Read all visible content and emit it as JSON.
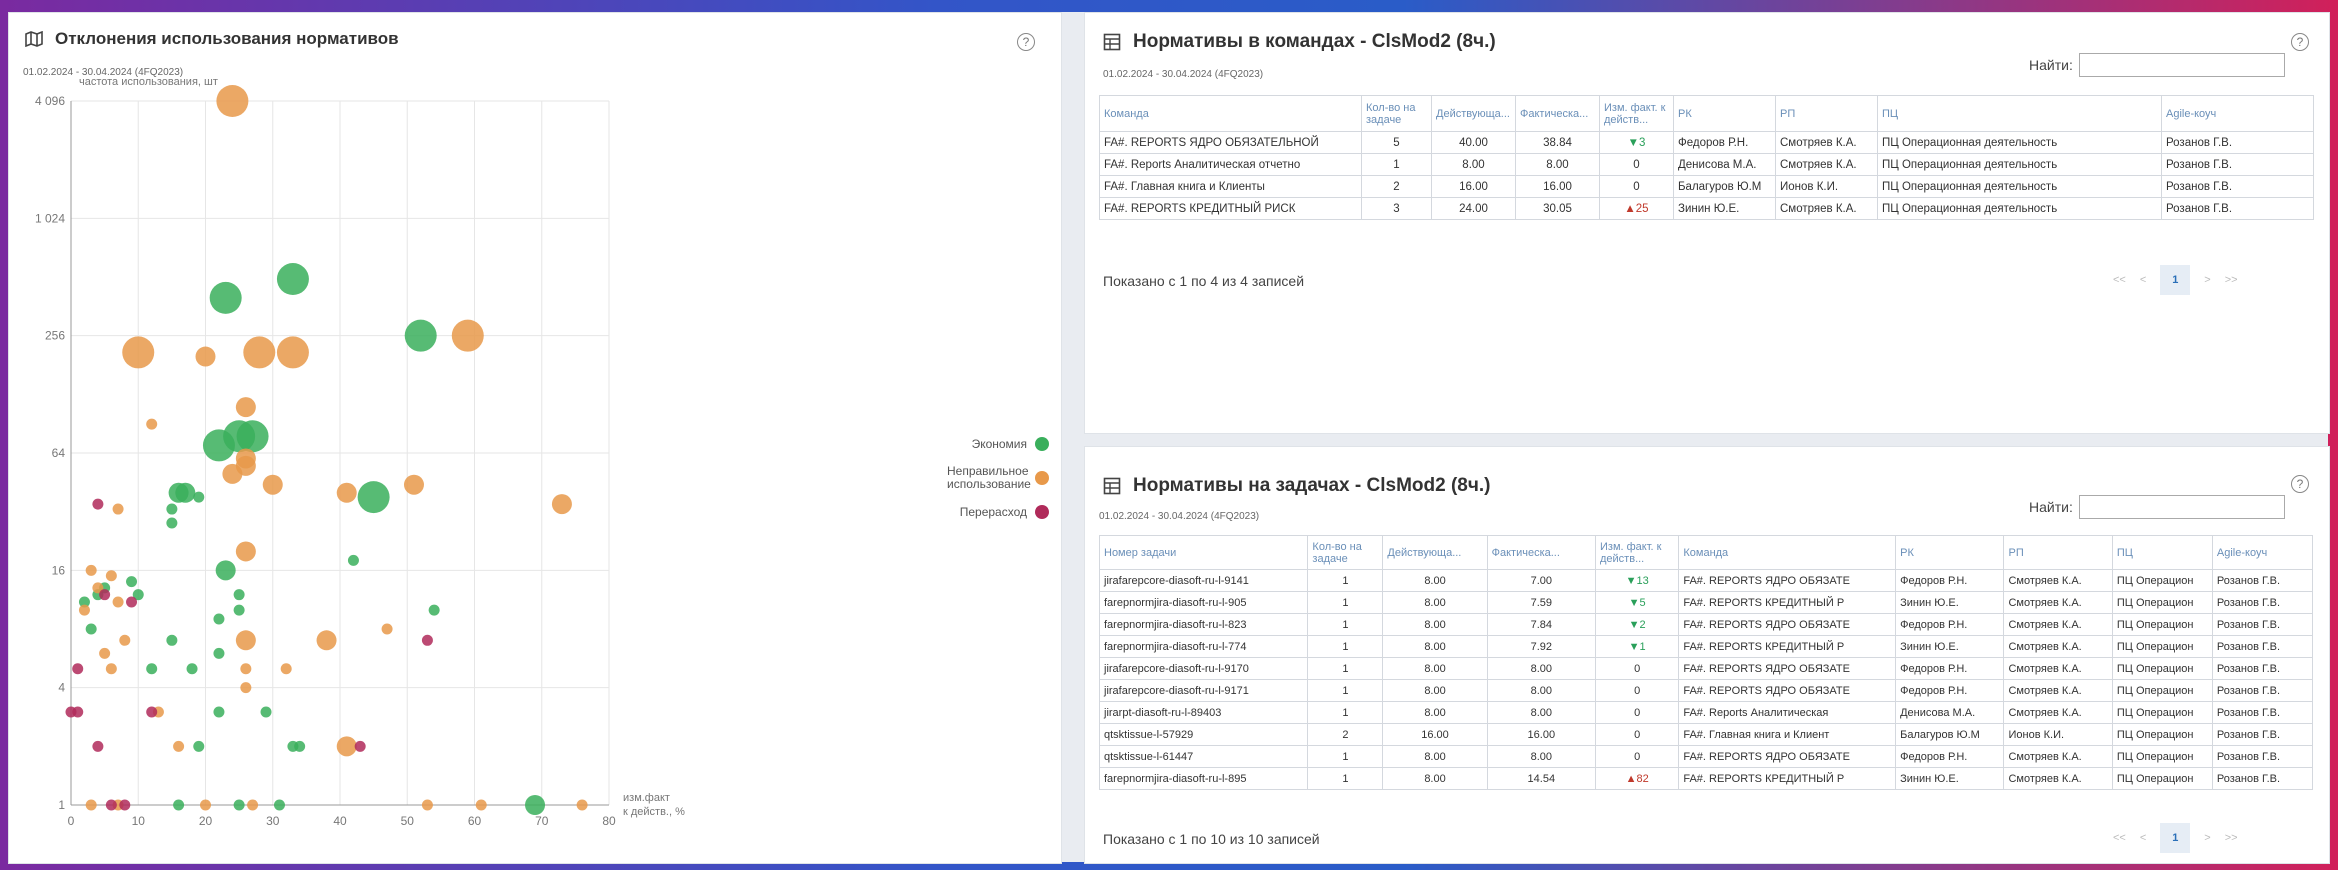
{
  "left_panel": {
    "title": "Отклонения использования нормативов",
    "date_range": "01.02.2024 - 30.04.2024 (4FQ2023)",
    "chart_data": {
      "type": "scatter",
      "ylabel": "частота использования, шт",
      "xlabel": "изм.факт к действ., %",
      "y_scale": "log2",
      "y_ticks": [
        "4 096",
        "1 024",
        "256",
        "64",
        "16",
        "4",
        "1"
      ],
      "y_tick_values": [
        4096,
        1024,
        256,
        64,
        16,
        4,
        1
      ],
      "x_ticks": [
        "0",
        "10",
        "20",
        "30",
        "40",
        "50",
        "60",
        "70",
        "80"
      ],
      "x_tick_values": [
        0,
        10,
        20,
        30,
        40,
        50,
        60,
        70,
        80
      ],
      "xlim": [
        0,
        80
      ],
      "grid": true,
      "legend_position": "right",
      "series": [
        {
          "name": "Экономия",
          "color": "#3aaf5c",
          "points": [
            [
              23,
              400,
              3
            ],
            [
              33,
              500,
              3
            ],
            [
              52,
              256,
              3
            ],
            [
              22,
              70,
              3
            ],
            [
              25,
              78,
              3
            ],
            [
              27,
              78,
              3
            ],
            [
              45,
              38,
              3
            ],
            [
              16,
              40,
              2
            ],
            [
              17,
              40,
              2
            ],
            [
              15,
              33,
              1
            ],
            [
              19,
              38,
              1
            ],
            [
              15,
              28,
              1
            ],
            [
              23,
              16,
              2
            ],
            [
              25,
              12,
              1
            ],
            [
              25,
              10,
              1
            ],
            [
              10,
              12,
              1
            ],
            [
              42,
              18,
              1
            ],
            [
              54,
              10,
              1
            ],
            [
              9,
              14,
              1
            ],
            [
              5,
              13,
              1
            ],
            [
              2,
              11,
              1
            ],
            [
              4,
              12,
              1
            ],
            [
              3,
              8,
              1
            ],
            [
              15,
              7,
              1
            ],
            [
              22,
              9,
              1
            ],
            [
              22,
              6,
              1
            ],
            [
              12,
              5,
              1
            ],
            [
              18,
              5,
              1
            ],
            [
              22,
              3,
              1
            ],
            [
              29,
              3,
              1
            ],
            [
              19,
              2,
              1
            ],
            [
              34,
              2,
              1
            ],
            [
              33,
              2,
              1
            ],
            [
              16,
              1,
              1
            ],
            [
              25,
              1,
              1
            ],
            [
              31,
              1,
              1
            ],
            [
              69,
              1,
              2
            ]
          ]
        },
        {
          "name": "Неправильное использование",
          "color": "#e8994a",
          "points": [
            [
              24,
              4096,
              3
            ],
            [
              10,
              210,
              3
            ],
            [
              28,
              210,
              3
            ],
            [
              33,
              210,
              3
            ],
            [
              59,
              256,
              3
            ],
            [
              20,
              200,
              2
            ],
            [
              26,
              110,
              2
            ],
            [
              12,
              90,
              1
            ],
            [
              26,
              60,
              2
            ],
            [
              26,
              55,
              2
            ],
            [
              24,
              50,
              2
            ],
            [
              30,
              44,
              2
            ],
            [
              41,
              40,
              2
            ],
            [
              51,
              44,
              2
            ],
            [
              73,
              35,
              2
            ],
            [
              26,
              20,
              2
            ],
            [
              7,
              33,
              1
            ],
            [
              3,
              16,
              1
            ],
            [
              6,
              15,
              1
            ],
            [
              4,
              13,
              1
            ],
            [
              2,
              10,
              1
            ],
            [
              7,
              11,
              1
            ],
            [
              8,
              7,
              1
            ],
            [
              5,
              6,
              1
            ],
            [
              6,
              5,
              1
            ],
            [
              26,
              7,
              2
            ],
            [
              38,
              7,
              2
            ],
            [
              26,
              5,
              1
            ],
            [
              47,
              8,
              1
            ],
            [
              32,
              5,
              1
            ],
            [
              26,
              4,
              1
            ],
            [
              13,
              3,
              1
            ],
            [
              41,
              2,
              2
            ],
            [
              16,
              2,
              1
            ],
            [
              3,
              1,
              1
            ],
            [
              7,
              1,
              1
            ],
            [
              20,
              1,
              1
            ],
            [
              27,
              1,
              1
            ],
            [
              53,
              1,
              1
            ],
            [
              61,
              1,
              1
            ],
            [
              76,
              1,
              1
            ]
          ]
        },
        {
          "name": "Перерасход",
          "color": "#b02a5a",
          "points": [
            [
              4,
              35,
              1
            ],
            [
              5,
              12,
              1
            ],
            [
              9,
              11,
              1
            ],
            [
              1,
              5,
              1
            ],
            [
              0,
              3,
              1
            ],
            [
              1,
              3,
              1
            ],
            [
              4,
              2,
              1
            ],
            [
              12,
              3,
              1
            ],
            [
              43,
              2,
              1
            ],
            [
              53,
              7,
              1
            ],
            [
              6,
              1,
              1
            ],
            [
              8,
              1,
              1
            ]
          ]
        }
      ]
    },
    "legend": [
      "Экономия",
      "Неправильное использование",
      "Перерасход"
    ]
  },
  "teams_panel": {
    "title": "Нормативы в командах - ClsMod2 (8ч.)",
    "date_range": "01.02.2024 - 30.04.2024 (4FQ2023)",
    "search_label": "Найти:",
    "columns": [
      "Команда",
      "Кол-во на задаче",
      "Действующа...",
      "Фактическа...",
      "Изм. факт. к действ...",
      "РК",
      "РП",
      "ПЦ",
      "Agile-коуч"
    ],
    "rows": [
      [
        "FA#. REPORTS ЯДРО ОБЯЗАТЕЛЬНОЙ",
        "5",
        "40.00",
        "38.84",
        "▼3",
        "Федоров Р.Н.",
        "Смотряев К.А.",
        "ПЦ Операционная деятельность",
        "Розанов Г.В."
      ],
      [
        "FA#. Reports Аналитическая отчетно",
        "1",
        "8.00",
        "8.00",
        "0",
        "Денисова М.А.",
        "Смотряев К.А.",
        "ПЦ Операционная деятельность",
        "Розанов Г.В."
      ],
      [
        "FA#. Главная книга и Клиенты",
        "2",
        "16.00",
        "16.00",
        "0",
        "Балагуров Ю.М",
        "Ионов К.И.",
        "ПЦ Операционная деятельность",
        "Розанов Г.В."
      ],
      [
        "FA#. REPORTS КРЕДИТНЫЙ РИСК",
        "3",
        "24.00",
        "30.05",
        "▲25",
        "Зинин Ю.Е.",
        "Смотряев К.А.",
        "ПЦ Операционная деятельность",
        "Розанов Г.В."
      ]
    ],
    "info": "Показано с 1 по 4 из 4 записей",
    "pager": {
      "first": "<<",
      "prev": "<",
      "current": "1",
      "next": ">",
      "last": ">>"
    }
  },
  "tasks_panel": {
    "title": "Нормативы на задачах - ClsMod2 (8ч.)",
    "date_range": "01.02.2024 - 30.04.2024 (4FQ2023)",
    "search_label": "Найти:",
    "columns": [
      "Номер задачи",
      "Кол-во на задаче",
      "Действующа...",
      "Фактическа...",
      "Изм. факт. к действ...",
      "Команда",
      "РК",
      "РП",
      "ПЦ",
      "Agile-коуч"
    ],
    "rows": [
      [
        "jirafarepcore-diasoft-ru-l-9141",
        "1",
        "8.00",
        "7.00",
        "▼13",
        "FA#. REPORTS ЯДРО ОБЯЗАТЕ",
        "Федоров Р.Н.",
        "Смотряев К.А.",
        "ПЦ Операцион",
        "Розанов Г.В."
      ],
      [
        "farepnormjira-diasoft-ru-l-905",
        "1",
        "8.00",
        "7.59",
        "▼5",
        "FA#. REPORTS КРЕДИТНЫЙ Р",
        "Зинин Ю.Е.",
        "Смотряев К.А.",
        "ПЦ Операцион",
        "Розанов Г.В."
      ],
      [
        "farepnormjira-diasoft-ru-l-823",
        "1",
        "8.00",
        "7.84",
        "▼2",
        "FA#. REPORTS ЯДРО ОБЯЗАТЕ",
        "Федоров Р.Н.",
        "Смотряев К.А.",
        "ПЦ Операцион",
        "Розанов Г.В."
      ],
      [
        "farepnormjira-diasoft-ru-l-774",
        "1",
        "8.00",
        "7.92",
        "▼1",
        "FA#. REPORTS КРЕДИТНЫЙ Р",
        "Зинин Ю.Е.",
        "Смотряев К.А.",
        "ПЦ Операцион",
        "Розанов Г.В."
      ],
      [
        "jirafarepcore-diasoft-ru-l-9170",
        "1",
        "8.00",
        "8.00",
        "0",
        "FA#. REPORTS ЯДРО ОБЯЗАТЕ",
        "Федоров Р.Н.",
        "Смотряев К.А.",
        "ПЦ Операцион",
        "Розанов Г.В."
      ],
      [
        "jirafarepcore-diasoft-ru-l-9171",
        "1",
        "8.00",
        "8.00",
        "0",
        "FA#. REPORTS ЯДРО ОБЯЗАТЕ",
        "Федоров Р.Н.",
        "Смотряев К.А.",
        "ПЦ Операцион",
        "Розанов Г.В."
      ],
      [
        "jirarpt-diasoft-ru-l-89403",
        "1",
        "8.00",
        "8.00",
        "0",
        "FA#. Reports Аналитическая",
        "Денисова М.А.",
        "Смотряев К.А.",
        "ПЦ Операцион",
        "Розанов Г.В."
      ],
      [
        "qtsktissue-l-57929",
        "2",
        "16.00",
        "16.00",
        "0",
        "FA#. Главная книга и Клиент",
        "Балагуров Ю.М",
        "Ионов К.И.",
        "ПЦ Операцион",
        "Розанов Г.В."
      ],
      [
        "qtsktissue-l-61447",
        "1",
        "8.00",
        "8.00",
        "0",
        "FA#. REPORTS ЯДРО ОБЯЗАТЕ",
        "Федоров Р.Н.",
        "Смотряев К.А.",
        "ПЦ Операцион",
        "Розанов Г.В."
      ],
      [
        "farepnormjira-diasoft-ru-l-895",
        "1",
        "8.00",
        "14.54",
        "▲82",
        "FA#. REPORTS КРЕДИТНЫЙ Р",
        "Зинин Ю.Е.",
        "Смотряев К.А.",
        "ПЦ Операцион",
        "Розанов Г.В."
      ]
    ],
    "info": "Показано с 1 по 10 из 10 записей",
    "pager": {
      "first": "<<",
      "prev": "<",
      "current": "1",
      "next": ">",
      "last": ">>"
    }
  },
  "help_symbol": "?"
}
